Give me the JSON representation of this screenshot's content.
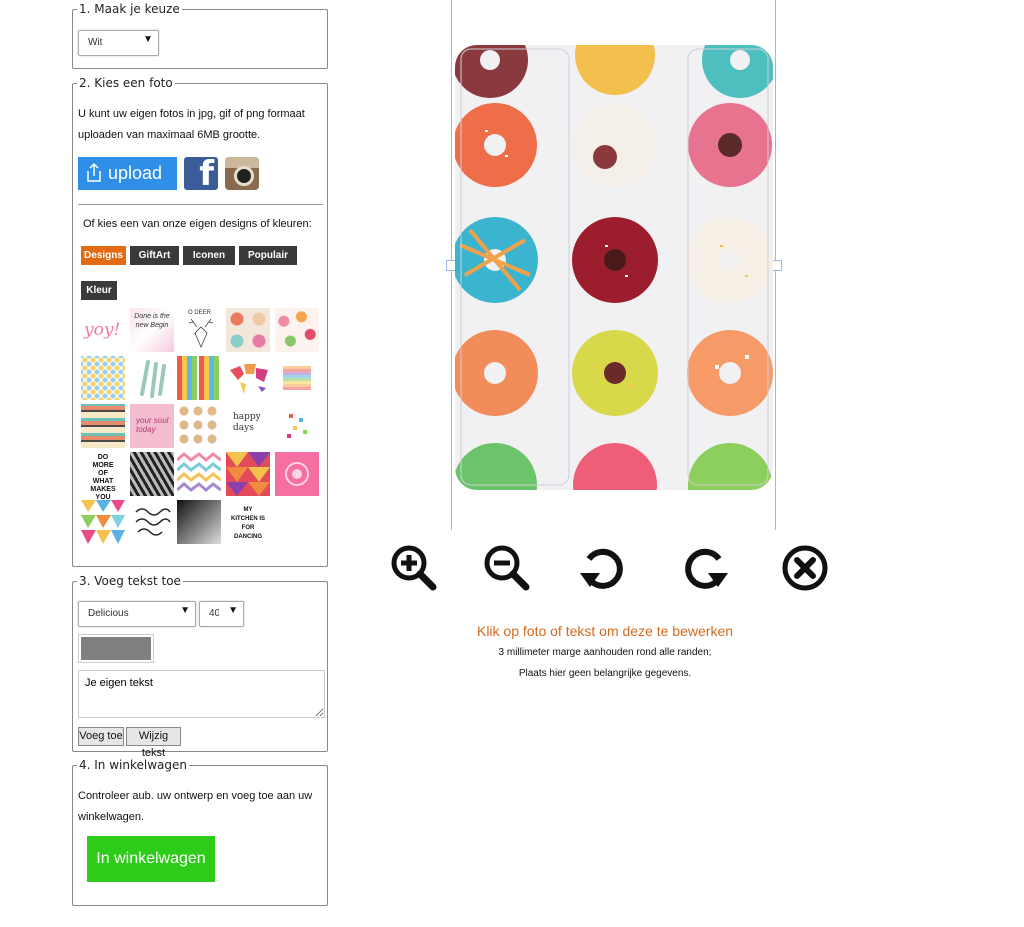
{
  "step1": {
    "legend": "1. Maak je keuze",
    "select_value": "Wit"
  },
  "step2": {
    "legend": "2. Kies een foto",
    "intro_line1": "U kunt uw eigen fotos in jpg, gif of png formaat",
    "intro_line2": "uploaden van maximaal 6MB grootte.",
    "upload_label": "upload",
    "facebook_icon": "facebook-icon",
    "instagram_icon": "instagram-icon",
    "choose_text": "Of kies een van onze eigen designs of kleuren:",
    "tabs": [
      "Designs",
      "GiftArt",
      "Iconen",
      "Populair",
      "Kleur"
    ],
    "active_tab_color": "#e26a12",
    "thumbnails": [
      {
        "name": "yoy-lettering",
        "text": "yoy!"
      },
      {
        "name": "done-begin",
        "text": "Done is the new Begin"
      },
      {
        "name": "deer-sketch",
        "text": "O DEER"
      },
      {
        "name": "donuts-pattern",
        "text": ""
      },
      {
        "name": "flowers-pattern",
        "text": ""
      },
      {
        "name": "dots-pattern",
        "text": ""
      },
      {
        "name": "feathers",
        "text": ""
      },
      {
        "name": "popsicles",
        "text": ""
      },
      {
        "name": "world-map",
        "text": ""
      },
      {
        "name": "rainbow-quote",
        "text": ""
      },
      {
        "name": "aztec-pattern",
        "text": ""
      },
      {
        "name": "pink-quote",
        "text": ""
      },
      {
        "name": "pugs-pattern",
        "text": ""
      },
      {
        "name": "happy-days",
        "text": "happy days"
      },
      {
        "name": "confetti",
        "text": ""
      },
      {
        "name": "do-more-poster",
        "text": "DO MORE OF WHAT MAKES YOU HAPPY."
      },
      {
        "name": "tiger-bw",
        "text": ""
      },
      {
        "name": "chevron-pastel",
        "text": ""
      },
      {
        "name": "triangles-color",
        "text": ""
      },
      {
        "name": "pink-ornament",
        "text": ""
      },
      {
        "name": "color-triangles-2",
        "text": ""
      },
      {
        "name": "script-quote",
        "text": ""
      },
      {
        "name": "woman-bw",
        "text": ""
      },
      {
        "name": "kitchen-dancing",
        "text": "MY KITCHEN IS FOR DANCING"
      }
    ]
  },
  "step3": {
    "legend": "3. Voeg tekst toe",
    "font_value": "Delicious",
    "size_value": "40",
    "text_value": "Je eigen tekst",
    "swatch_color": "#808080",
    "add_label": "Voeg toe",
    "edit_label": "Wijzig tekst"
  },
  "step4": {
    "legend": "4. In winkelwagen",
    "text_line1": "Controleer aub. uw ontwerp en voeg toe aan uw",
    "text_line2": "winkelwagen.",
    "cart_label": "In winkelwagen"
  },
  "canvas": {
    "photo": "donuts-photo",
    "controls": [
      "zoom-in-icon",
      "zoom-out-icon",
      "rotate-left-icon",
      "rotate-right-icon",
      "remove-icon"
    ],
    "note_title": "Klik op foto of tekst om deze te bewerken",
    "note_line1": "3 millimeter marge aanhouden rond alle randen;",
    "note_line2": "Plaats hier geen belangrijke gegevens."
  }
}
